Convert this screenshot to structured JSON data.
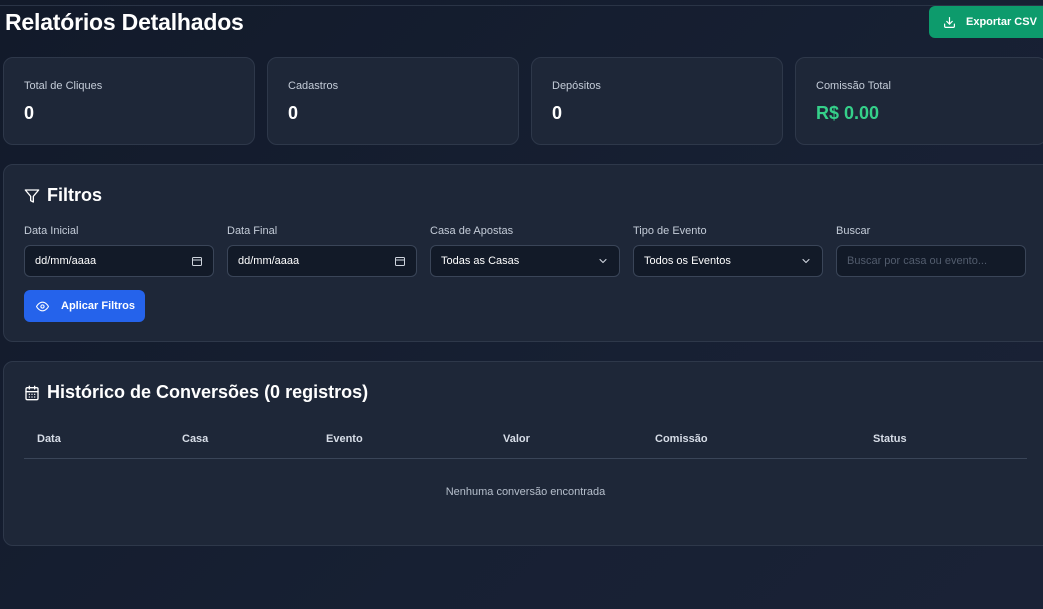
{
  "header": {
    "title": "Relatórios Detalhados",
    "export_label": "Exportar CSV"
  },
  "stats": [
    {
      "label": "Total de Cliques",
      "value": "0"
    },
    {
      "label": "Cadastros",
      "value": "0"
    },
    {
      "label": "Depósitos",
      "value": "0"
    },
    {
      "label": "Comissão Total",
      "value": "R$ 0.00"
    }
  ],
  "filters": {
    "title": "Filtros",
    "start_date": {
      "label": "Data Inicial",
      "value": "dd/mm/aaaa"
    },
    "end_date": {
      "label": "Data Final",
      "value": "dd/mm/aaaa"
    },
    "house": {
      "label": "Casa de Apostas",
      "value": "Todas as Casas"
    },
    "event_type": {
      "label": "Tipo de Evento",
      "value": "Todos os Eventos"
    },
    "search": {
      "label": "Buscar",
      "placeholder": "Buscar por casa ou evento..."
    },
    "apply_label": "Aplicar Filtros"
  },
  "history": {
    "title": "Histórico de Conversões (0 registros)",
    "columns": [
      "Data",
      "Casa",
      "Evento",
      "Valor",
      "Comissão",
      "Status"
    ],
    "empty_message": "Nenhuma conversão encontrada"
  },
  "colors": {
    "background": "#172033",
    "card": "#1e2738",
    "export_button": "#0d9b6c",
    "apply_button": "#2563eb",
    "commission_value": "#35d08a"
  },
  "icons": {
    "export": "download-icon",
    "filters": "filter-icon",
    "date_picker": "calendar-icon",
    "select": "chevron-down-icon",
    "apply": "eye-icon",
    "history": "calendar-icon"
  }
}
